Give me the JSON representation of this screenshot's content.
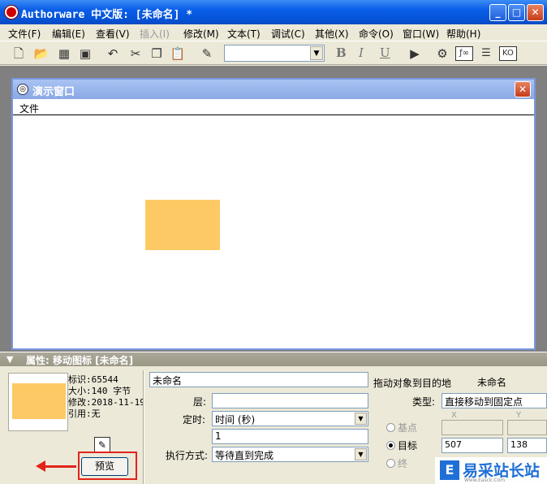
{
  "window": {
    "title": "Authorware 中文版: [未命名] *",
    "minimize": "_",
    "maximize": "□",
    "close": "✕"
  },
  "menu": [
    {
      "label": "文件(F)",
      "enabled": true
    },
    {
      "label": "编辑(E)",
      "enabled": true
    },
    {
      "label": "查看(V)",
      "enabled": true
    },
    {
      "label": "插入(I)",
      "enabled": false
    },
    {
      "label": "修改(M)",
      "enabled": true
    },
    {
      "label": "文本(T)",
      "enabled": true
    },
    {
      "label": "调试(C)",
      "enabled": true
    },
    {
      "label": "其他(X)",
      "enabled": true
    },
    {
      "label": "命令(O)",
      "enabled": true
    },
    {
      "label": "窗口(W)",
      "enabled": true
    },
    {
      "label": "帮助(H)",
      "enabled": true
    }
  ],
  "toolbar": {
    "icons": [
      "new-file-icon",
      "open-folder-icon",
      "save-all-icon",
      "import-icon",
      "undo-icon",
      "cut-icon",
      "copy-icon",
      "paste-icon",
      "find-icon"
    ],
    "font_value": "",
    "bold": "B",
    "italic": "I",
    "underline": "U",
    "right_icons": [
      "run-icon",
      "control-panel-icon",
      "function-icon",
      "variable-icon",
      "knowledge-objects-icon"
    ]
  },
  "presentation_window": {
    "title": "演示窗口",
    "menu_file": "文件",
    "close": "✕",
    "box_color": "#fdc964"
  },
  "properties": {
    "header": "属性: 移动图标 [未命名]",
    "id_label": "标识:65544",
    "size_label": "大小:140 字节",
    "modified_label": "修改:2018-11-19",
    "ref_label": "引用:无",
    "preview_button": "预览",
    "name_value": "未命名",
    "layer_label": "层:",
    "layer_value": "",
    "timing_label": "定时:",
    "timing_value": "时间  (秒)",
    "timing_number": "1",
    "exec_label": "执行方式:",
    "exec_value": "等待直到完成",
    "drag_label": "拖动对象到目的地",
    "drag_target": "未命名",
    "type_label": "类型:",
    "type_value": "直接移动到固定点",
    "base_label": "基点",
    "target_label": "目标",
    "end_label": "终",
    "x_label": "X",
    "y_label": "Y",
    "target_x": "507",
    "target_y": "138"
  },
  "watermark": {
    "logo": "E",
    "text": "易采站长站",
    "url": "Www.Easck.Com"
  }
}
